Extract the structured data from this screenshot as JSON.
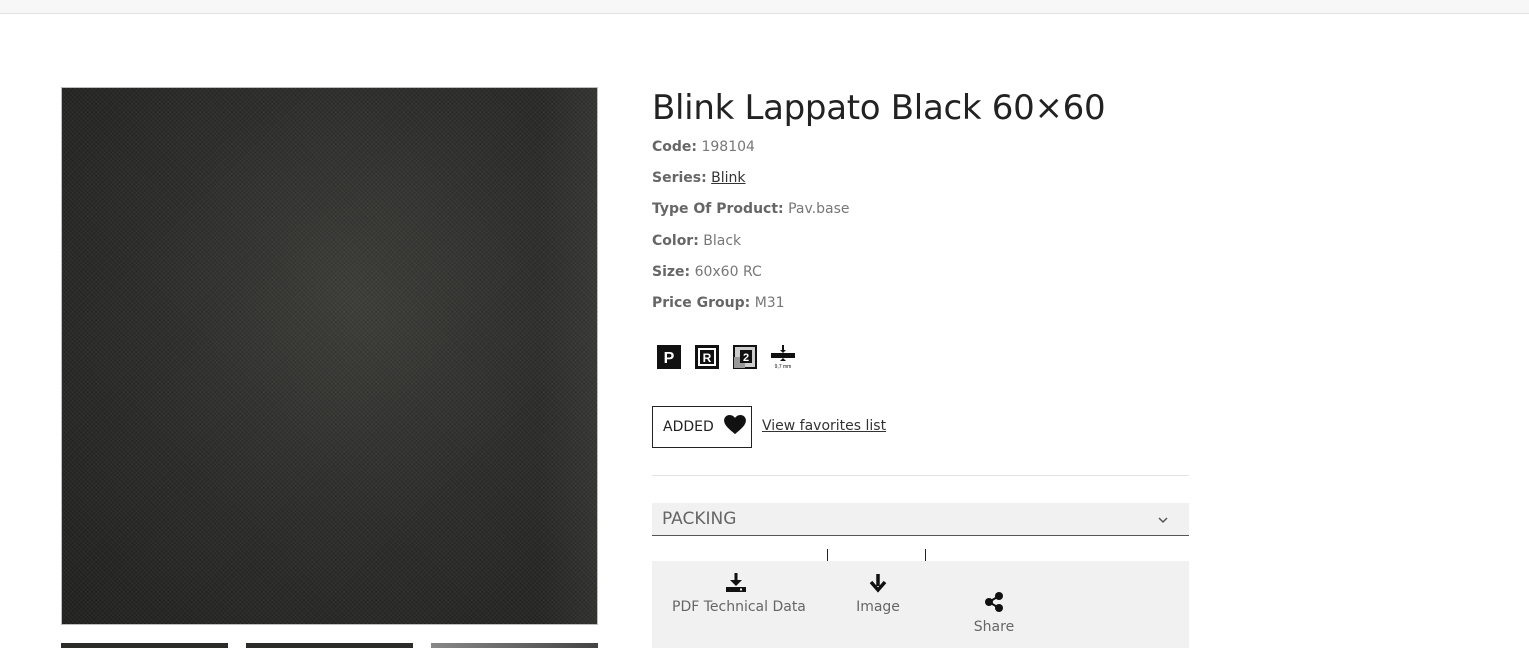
{
  "product": {
    "title": "Blink Lappato Black 60×60",
    "specs": [
      {
        "label": "Code:",
        "value": "198104"
      },
      {
        "label": "Series:",
        "value": "Blink"
      },
      {
        "label": "Type Of Product:",
        "value": "Pav.base"
      },
      {
        "label": "Color:",
        "value": "Black"
      },
      {
        "label": "Size:",
        "value": "60x60 RC"
      },
      {
        "label": "Price Group:",
        "value": "M31"
      }
    ],
    "feature_icons": [
      {
        "name": "p-icon",
        "glyph": "P"
      },
      {
        "name": "r-icon",
        "glyph": "R"
      },
      {
        "name": "two-icon",
        "glyph": "2"
      },
      {
        "name": "thickness-icon",
        "glyph": "9,7 mm"
      }
    ]
  },
  "favorites": {
    "button_label": "ADDED",
    "link_label": "View favorites list"
  },
  "packing": {
    "label": "PACKING"
  },
  "downloads": {
    "pdf_label": "PDF Technical Data",
    "image_label": "Image",
    "share_label": "Share"
  },
  "colors": {
    "panel_bg": "#f1f1f1",
    "text": "#333333",
    "muted": "#777777"
  }
}
